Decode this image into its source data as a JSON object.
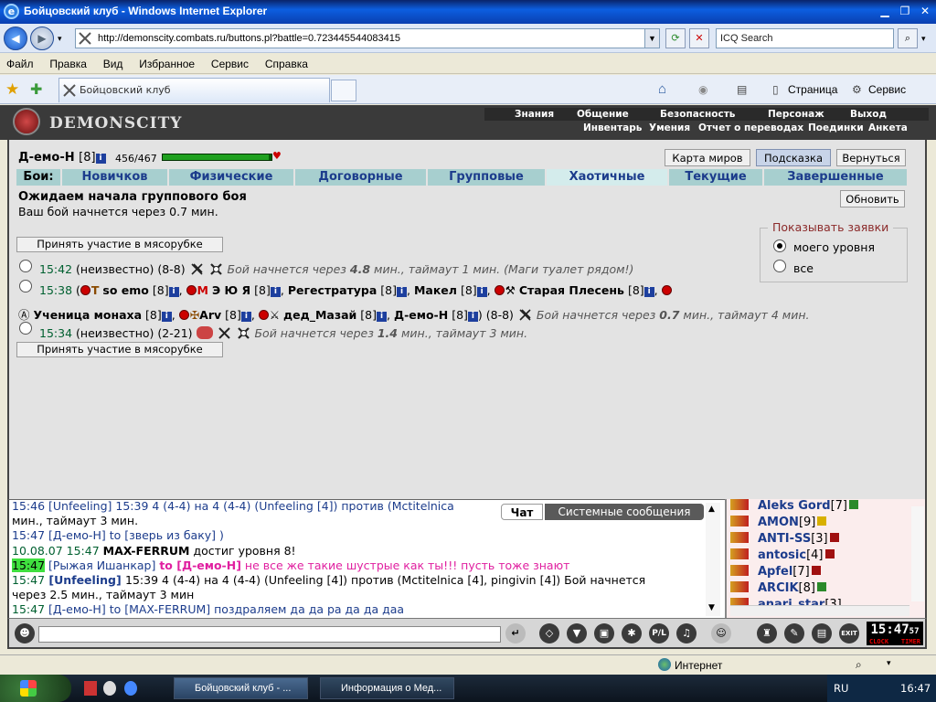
{
  "window": {
    "title": "Бойцовский клуб - Windows Internet Explorer"
  },
  "address": {
    "url": "http://demonscity.combats.ru/buttons.pl?battle=0.723445544083415",
    "search_placeholder": "ICQ Search"
  },
  "menu": [
    "Файл",
    "Правка",
    "Вид",
    "Избранное",
    "Сервис",
    "Справка"
  ],
  "tab": {
    "label": "Бойцовский клуб"
  },
  "toolbar": {
    "page": "Страница",
    "service": "Сервис"
  },
  "game": {
    "logo": "DEMONSCITY",
    "menu_top": [
      "Знания",
      "Общение",
      "Безопасность",
      "Персонаж",
      "Выход"
    ],
    "menu_bottom": [
      "Инвентарь",
      "Умения",
      "Отчет о переводах",
      "Поединки",
      "Анкета"
    ]
  },
  "player": {
    "name": "Д-емо-Н",
    "level": "[8]",
    "hp": "456/467",
    "hp_fraction": 0.976
  },
  "buttons": {
    "map": "Карта миров",
    "hint": "Подсказка",
    "back": "Вернуться",
    "refresh": "Обновить",
    "join": "Принять участие в мясорубке"
  },
  "battle_tabs": {
    "label": "Бои:",
    "items": [
      "Новичков",
      "Физические",
      "Договорные",
      "Групповые",
      "Хаотичные",
      "Текущие",
      "Завершенные"
    ],
    "active": 4
  },
  "status": {
    "heading": "Ожидаем начала группового боя",
    "sub": "Ваш бой начнется через 0.7 мин."
  },
  "show": {
    "legend": "Показывать заявки",
    "opt1": "моего уровня",
    "opt2": "все"
  },
  "rows": [
    {
      "time": "15:42",
      "who": "(неизвестно)",
      "range": "(8-8)",
      "note_a": "Бой начнется через ",
      "mins": "4.8",
      "note_b": " мин., таймаут 1 мин. (Маги туалет рядом!)"
    },
    {
      "time": "15:38",
      "p1": "so emo",
      "p2": "Э Ю Я",
      "p3": "Регестратура",
      "p4": "Макел",
      "p5": "Старая Плесень",
      "p6": "Ученица монаха",
      "p7": "Arv",
      "p8": "дед_Мазай",
      "p9": "Д-емо-Н",
      "lvl": "[8]",
      "range": "(8-8)",
      "note_a": "Бой начнется через ",
      "mins": "0.7",
      "note_b": " мин., таймаут 4 мин."
    },
    {
      "time": "15:34",
      "who": "(неизвестно)",
      "range": "(2-21)",
      "note_a": "Бой начнется через ",
      "mins": "1.4",
      "note_b": " мин., таймаут 3 мин."
    }
  ],
  "chat": {
    "tab1": "Чат",
    "tab2": "Системные сообщения",
    "l0": "15:46 [Unfeeling] 15:39 4 (4-4) на 4 (4-4) (Unfeeling [4]) против (Mctitelnica",
    "l1": "мин., таймаут 3 мин.",
    "l2t": "15:47",
    "l2n": "[Д-емо-Н]",
    "l2m": " to [зверь из баку] )",
    "l3a": "10.08.07 15:47 ",
    "l3b": "MAX-FERRUM",
    "l3c": " достиг уровня 8!",
    "l4t": "15:47",
    "l4n": " [Рыжая Ишанкар] ",
    "l4to": "to [Д-емо-Н]",
    "l4m": " не все же такие шустрые как ты!!! пусть тоже знают",
    "l5t": "15:47",
    "l5n": " [Unfeeling] ",
    "l5m": "15:39 4 (4-4) на 4 (4-4) (Unfeeling [4]) против (Mctitelnica [4], pingivin [4]) Бой начнется",
    "l6": "через 2.5 мин., таймаут 3 мин",
    "l7t": "15:47",
    "l7n": " [Д-емо-Н] ",
    "l7m": "to [MAX-FERRUM] поздраляем да да ра да да даа"
  },
  "users": [
    {
      "name": "Aleks Gord",
      "lvl": "[7]"
    },
    {
      "name": "AMON",
      "lvl": "[9]"
    },
    {
      "name": "ANTI-SS",
      "lvl": "[3]"
    },
    {
      "name": "antosic",
      "lvl": "[4]"
    },
    {
      "name": "Apfel",
      "lvl": "[7]"
    },
    {
      "name": "ARCIK",
      "lvl": "[8]"
    },
    {
      "name": "anari_star",
      "lvl": "[3]"
    }
  ],
  "clock": {
    "time": "15:47",
    "sec": "57",
    "labels": [
      "CLOCK",
      "TIMER"
    ]
  },
  "statusbar": {
    "zone": "Интернет"
  },
  "taskbar": {
    "task1": "Бойцовский клуб - ...",
    "task2": "Информация о Мед...",
    "lang": "RU",
    "time": "16:47"
  },
  "colors": {
    "accent": "#1c3c8c",
    "tabs": "#a7cfcf",
    "hp": "#006000"
  }
}
